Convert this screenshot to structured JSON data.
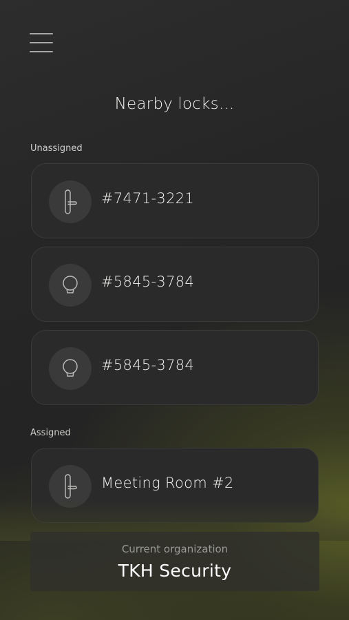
{
  "header": {
    "menu_icon": "hamburger-menu-icon",
    "title": "Nearby locks..."
  },
  "sections": {
    "unassigned": {
      "label": "Unassigned",
      "locks": [
        {
          "name": "#7471-3221",
          "icon": "door-handle-icon"
        },
        {
          "name": "#5845-3784",
          "icon": "round-knob-icon"
        },
        {
          "name": "#5845-3784",
          "icon": "round-knob-icon"
        }
      ]
    },
    "assigned": {
      "label": "Assigned",
      "locks": [
        {
          "name": "Meeting Room #2",
          "icon": "door-handle-icon"
        }
      ]
    }
  },
  "organization": {
    "caption": "Current organization",
    "name": "TKH Security"
  },
  "colors": {
    "background": "#262626",
    "card": "#2a2a2a",
    "icon_circle": "#3a3a3a",
    "accent_glow": "#626828"
  }
}
